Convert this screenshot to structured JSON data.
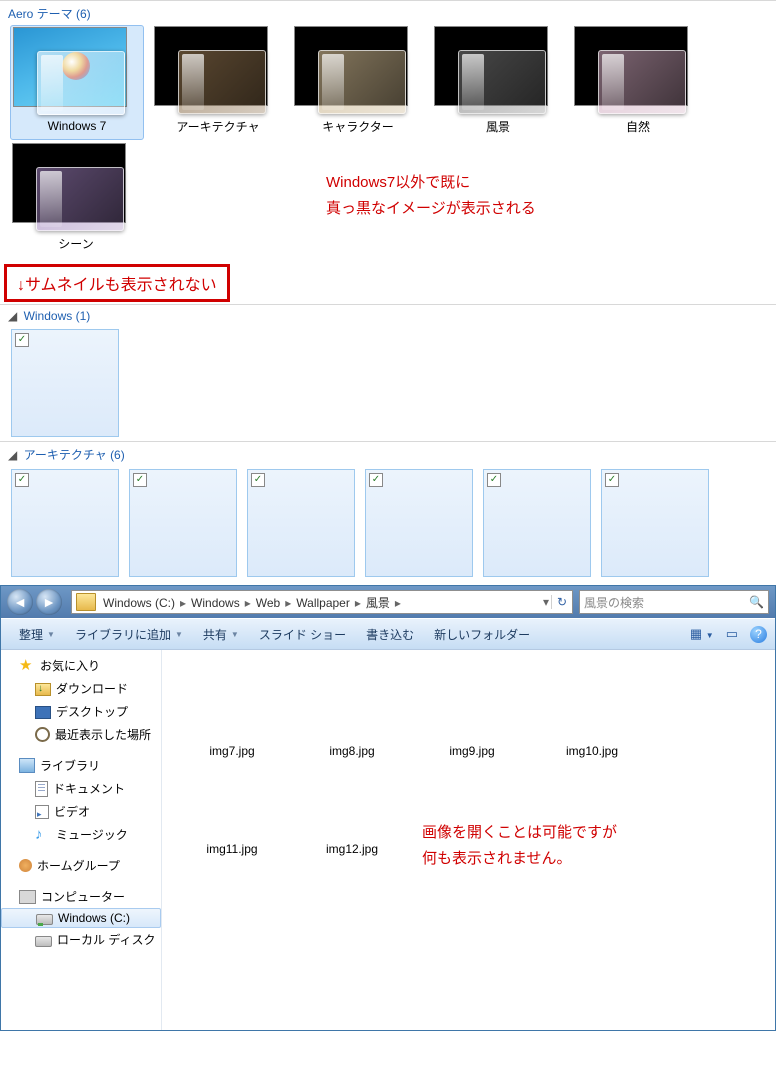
{
  "aero": {
    "header": "Aero テーマ (6)",
    "themes": [
      {
        "label": "Windows 7",
        "sel": true,
        "wall": "win7",
        "glass": ""
      },
      {
        "label": "アーキテクチャ",
        "wall": "black",
        "glass": "brown"
      },
      {
        "label": "キャラクター",
        "wall": "black",
        "glass": "beige"
      },
      {
        "label": "風景",
        "wall": "black",
        "glass": "gray"
      },
      {
        "label": "自然",
        "wall": "black",
        "glass": "pink"
      },
      {
        "label": "シーン",
        "wall": "black",
        "glass": "purple"
      }
    ]
  },
  "anno_black_1": "Windows7以外で既に",
  "anno_black_2": "真っ黒なイメージが表示される",
  "anno_thumb": "↓サムネイルも表示されない",
  "bggroups": [
    {
      "header": "Windows (1)",
      "count": 1
    },
    {
      "header": "アーキテクチャ (6)",
      "count": 6
    }
  ],
  "explorer": {
    "breadcrumbs": [
      "Windows (C:)",
      "Windows",
      "Web",
      "Wallpaper",
      "風景"
    ],
    "search_placeholder": "風景の検索",
    "toolbar": {
      "organize": "整理",
      "addlib": "ライブラリに追加",
      "share": "共有",
      "slideshow": "スライド ショー",
      "burn": "書き込む",
      "newfolder": "新しいフォルダー"
    },
    "sidebar": {
      "fav": "お気に入り",
      "fav_items": [
        {
          "l": "ダウンロード",
          "ic": "fold dl"
        },
        {
          "l": "デスクトップ",
          "ic": "mon"
        },
        {
          "l": "最近表示した場所",
          "ic": "hist"
        }
      ],
      "lib": "ライブラリ",
      "lib_items": [
        {
          "l": "ドキュメント",
          "ic": "doc"
        },
        {
          "l": "ビデオ",
          "ic": "vid"
        },
        {
          "l": "ミュージック",
          "ic": "mus"
        }
      ],
      "hg": "ホームグループ",
      "comp": "コンピューター",
      "comp_items": [
        {
          "l": "Windows (C:)",
          "ic": "drv c",
          "sel": true
        },
        {
          "l": "ローカル ディスク",
          "ic": "drv"
        }
      ]
    },
    "files": [
      "img7.jpg",
      "img8.jpg",
      "img9.jpg",
      "img10.jpg",
      "img11.jpg",
      "img12.jpg"
    ],
    "anno_open_1": "画像を開くことは可能ですが",
    "anno_open_2": "何も表示されません。"
  }
}
